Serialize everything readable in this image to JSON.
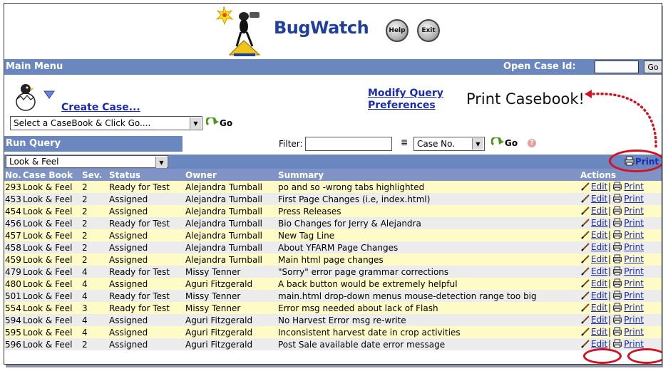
{
  "header": {
    "brand": "BugWatch",
    "help_label": "Help",
    "exit_label": "Exit"
  },
  "menubar": {
    "title": "Main Menu",
    "open_case_label": "Open Case Id:",
    "open_case_value": "",
    "go_label": "Go"
  },
  "create": {
    "create_link": "Create Case...",
    "casebook_select": "Select a CaseBook & Click Go....",
    "go_label": "Go",
    "modify_line1": "Modify Query",
    "modify_line2": "Preferences"
  },
  "annotation": {
    "print_casebook": "Print Casebook!"
  },
  "runquery": {
    "title": "Run Query",
    "filter_label": "Filter:",
    "filter_value": "",
    "sort_value": "Case No.",
    "go_label": "Go",
    "help_label": "?"
  },
  "casebook_filter": {
    "value": "Look & Feel",
    "print_label": "Print"
  },
  "table": {
    "headers": [
      "No.",
      "Case Book",
      "Sev.",
      "Status",
      "Owner",
      "Summary",
      "Actions"
    ],
    "edit_label": "Edit",
    "print_label": "Print",
    "rows": [
      [
        "293",
        "Look & Feel",
        "2",
        "Ready for Test",
        "Alejandra Turnball",
        "po and so -wrong tabs highlighted"
      ],
      [
        "453",
        "Look & Feel",
        "2",
        "Assigned",
        "Alejandra Turnball",
        "First Page Changes (i.e, index.html)"
      ],
      [
        "454",
        "Look & Feel",
        "2",
        "Assigned",
        "Alejandra Turnball",
        "Press Releases"
      ],
      [
        "456",
        "Look & Feel",
        "2",
        "Ready for Test",
        "Alejandra Turnball",
        "Bio Changes for Jerry & Alejandra"
      ],
      [
        "457",
        "Look & Feel",
        "2",
        "Assigned",
        "Alejandra Turnball",
        "New Tag Line"
      ],
      [
        "458",
        "Look & Feel",
        "2",
        "Assigned",
        "Alejandra Turnball",
        "About YFARM Page Changes"
      ],
      [
        "459",
        "Look & Feel",
        "2",
        "Assigned",
        "Alejandra Turnball",
        "Main html page changes"
      ],
      [
        "479",
        "Look & Feel",
        "4",
        "Ready for Test",
        "Missy Tenner",
        "\"Sorry\" error page grammar corrections"
      ],
      [
        "480",
        "Look & Feel",
        "4",
        "Assigned",
        "Aguri Fitzgerald",
        "A back button would be extremely helpful"
      ],
      [
        "501",
        "Look & Feel",
        "4",
        "Ready for Test",
        "Missy Tenner",
        "main.html drop-down menus mouse-detection range too big"
      ],
      [
        "554",
        "Look & Feel",
        "3",
        "Ready for Test",
        "Missy Tenner",
        "Error msg needed about lack of Flash"
      ],
      [
        "594",
        "Look & Feel",
        "4",
        "Assigned",
        "Aguri Fitzgerald",
        "No Harvest Error msg re-write"
      ],
      [
        "595",
        "Look & Feel",
        "4",
        "Assigned",
        "Aguri Fitzgerald",
        "Inconsistent harvest date in crop activities"
      ],
      [
        "596",
        "Look & Feel",
        "2",
        "Assigned",
        "Aguri Fitzgerald",
        "Post Sale available date error message"
      ]
    ]
  },
  "colors": {
    "bar_blue": "#6a87bf",
    "header_blue": "#7f94c5",
    "row_yellow": "#fffbc6",
    "row_gray": "#ececec",
    "link_blue": "#1a2bb0",
    "annotation_red": "#d4121f"
  }
}
